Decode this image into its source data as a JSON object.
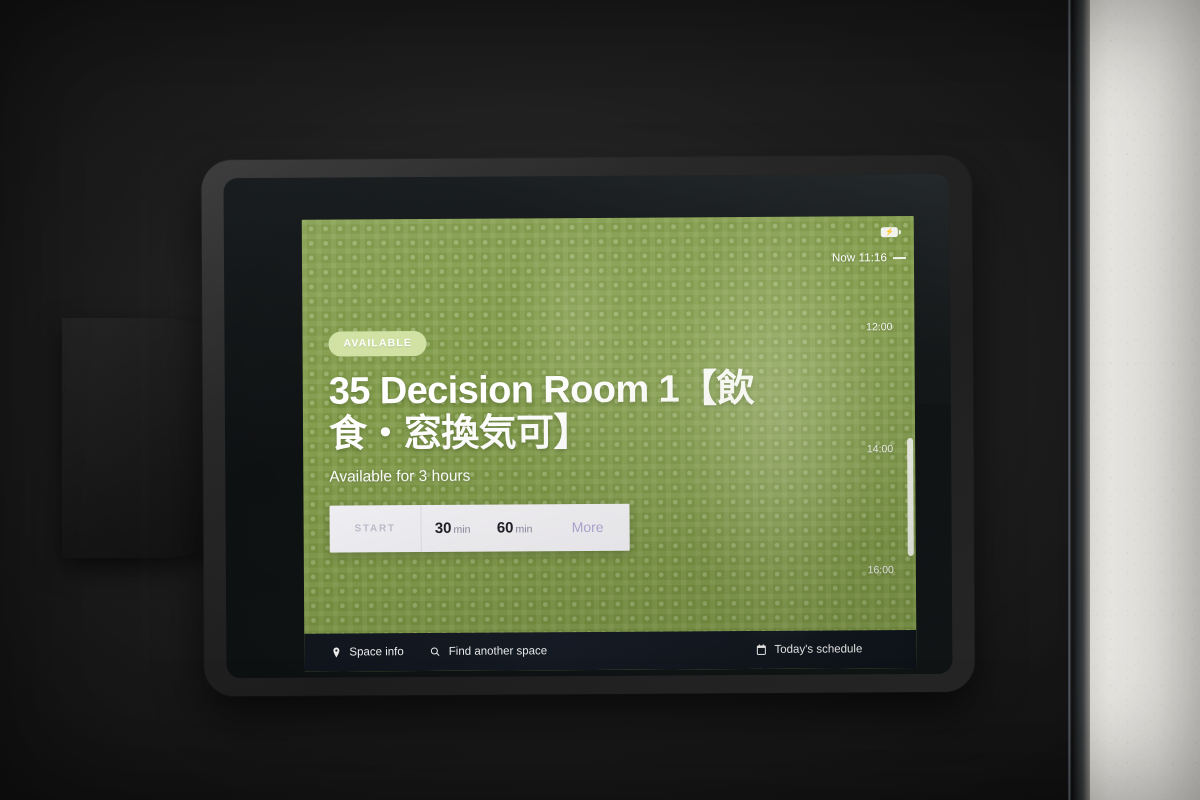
{
  "device": {
    "type": "wall-mounted-tablet",
    "bezel_color": "#14181a",
    "frame_color": "#242424"
  },
  "screen": {
    "background_color": "#77923f",
    "accent_badge_color": "#cfe0a0",
    "status": {
      "badge_label": "AVAILABLE",
      "battery_icon": "battery-charging-icon",
      "battery_glyph": "⚡"
    },
    "room": {
      "title": "35 Decision Room 1【飲食・窓換気可】",
      "availability_text": "Available for 3 hours"
    },
    "action_bar": {
      "start_label": "START",
      "options": [
        {
          "value": "30",
          "unit": "min"
        },
        {
          "value": "60",
          "unit": "min"
        }
      ],
      "more_label": "More",
      "background_color": "#f5f4f8",
      "more_color": "#b3a8d6"
    },
    "timeline": {
      "now_label": "Now 11:16",
      "ticks": [
        "12:00",
        "14:00",
        "16:00"
      ],
      "has_scroll_indicator": true
    },
    "bottom_nav": {
      "background_color": "#0f141c",
      "items": [
        {
          "label": "Space info",
          "icon": "location-pin-icon",
          "align": "left"
        },
        {
          "label": "Find another space",
          "icon": "search-icon",
          "align": "left"
        },
        {
          "label": "Today's schedule",
          "icon": "calendar-icon",
          "align": "right"
        }
      ]
    }
  },
  "environment": {
    "wall_dark_color": "#1a1a1a",
    "wall_light_color": "#f3f1ec",
    "mount_plate_color": "#151515"
  }
}
